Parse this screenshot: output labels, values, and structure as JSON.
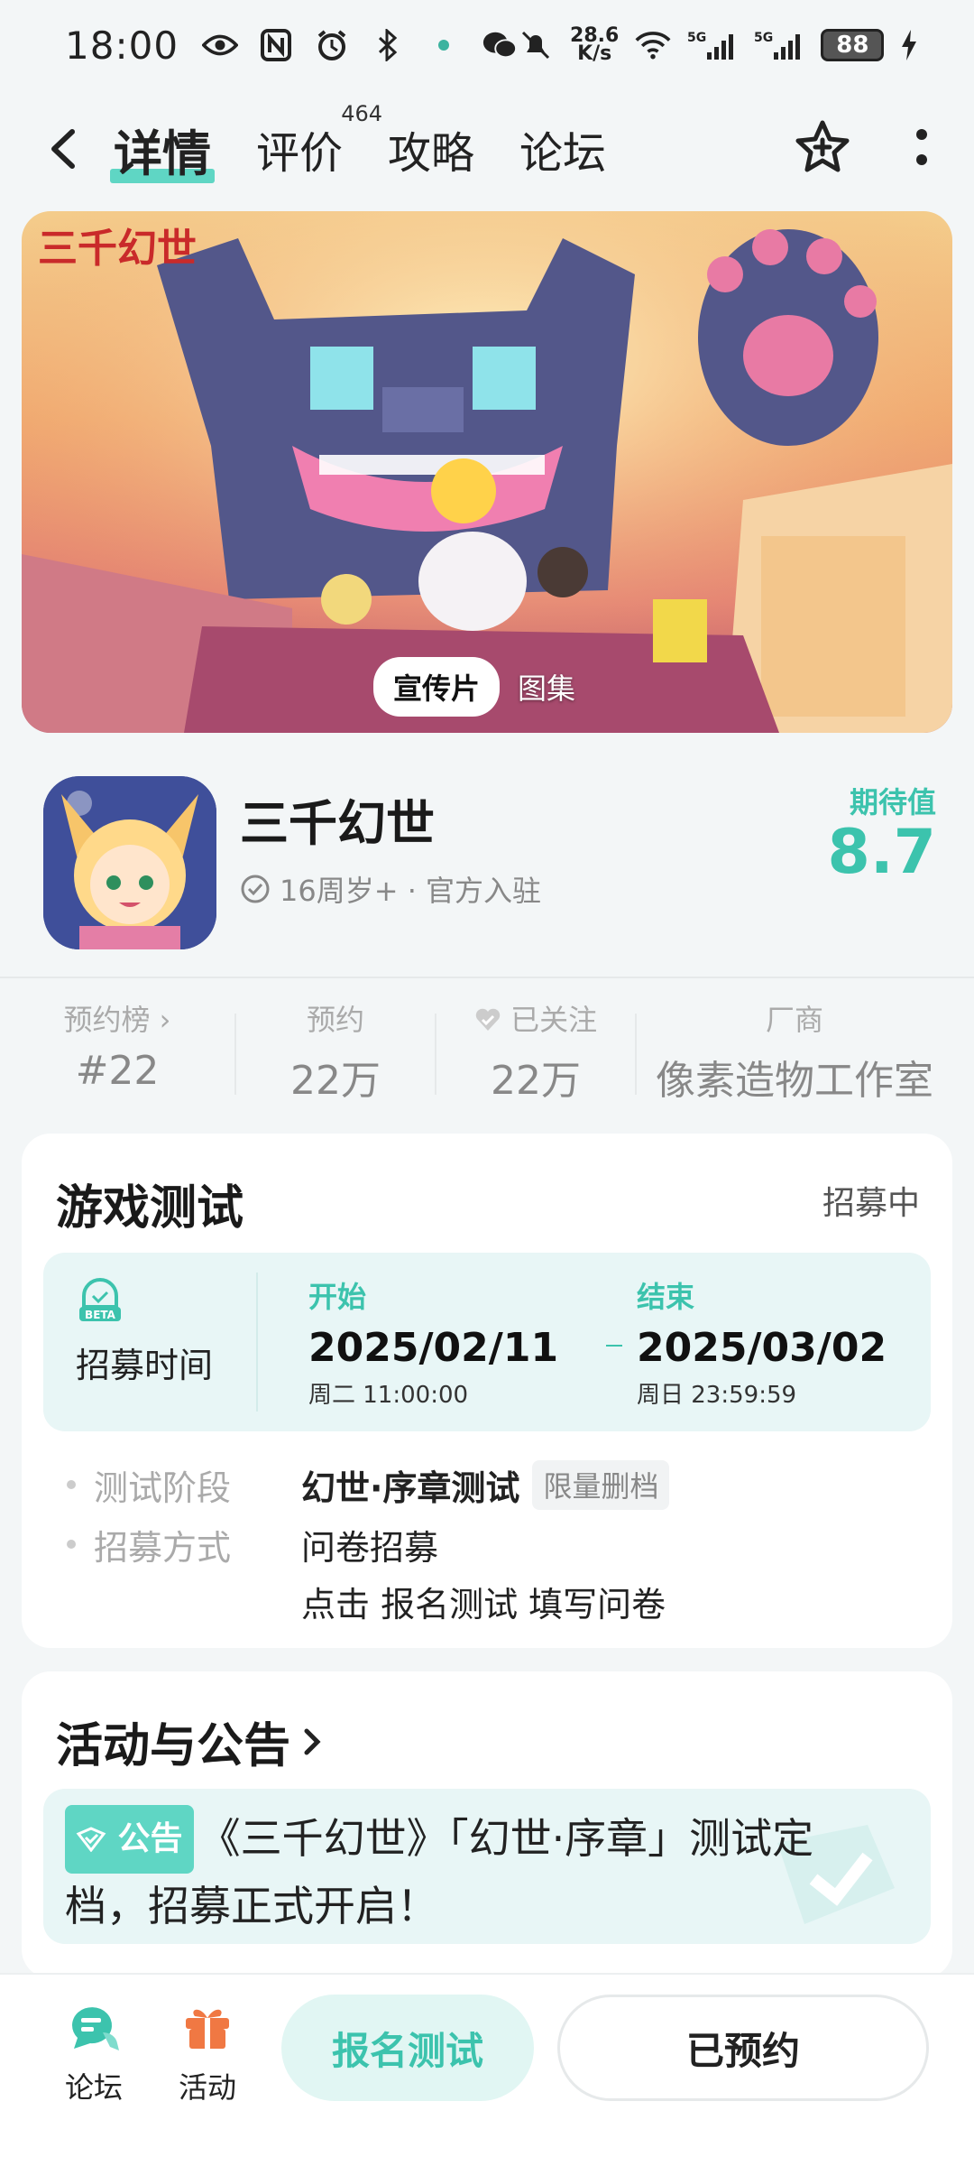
{
  "status_bar": {
    "time": "18:00",
    "net_speed_value": "28.6",
    "net_speed_unit": "K/s",
    "sig1": "5G",
    "sig2": "5G",
    "battery": "88"
  },
  "nav": {
    "tabs": [
      {
        "label": "详情",
        "active": true
      },
      {
        "label": "评价",
        "count": "464"
      },
      {
        "label": "攻略"
      },
      {
        "label": "论坛"
      }
    ]
  },
  "banner": {
    "tab_video": "宣传片",
    "tab_gallery": "图集",
    "logo_text": "三千幻世"
  },
  "game": {
    "title": "三千幻世",
    "meta": "16周岁+ · 官方入驻",
    "expect_label": "期待值",
    "expect_value": "8.7"
  },
  "stats": [
    {
      "label": "预约榜 ›",
      "value": "#22"
    },
    {
      "label": "预约",
      "value": "22万"
    },
    {
      "label": "已关注",
      "value": "22万"
    },
    {
      "label": "厂商",
      "value": "像素造物工作室"
    }
  ],
  "test_card": {
    "title": "游戏测试",
    "status": "招募中",
    "recruit_label": "招募时间",
    "beta": "BETA",
    "start_label": "开始",
    "start_date": "2025/02/11",
    "start_time": "周二  11:00:00",
    "end_label": "结束",
    "end_date": "2025/03/02",
    "end_time": "周日  23:59:59",
    "phase_label": "测试阶段",
    "phase_value": "幻世·序章测试",
    "phase_tag": "限量删档",
    "method_label": "招募方式",
    "method_value": "问卷招募",
    "method_hint": "点击 报名测试 填写问卷"
  },
  "activity_card": {
    "title": "活动与公告",
    "badge": "公告",
    "notice": "《三千幻世》「幻世·序章」测试定档，招募正式开启！"
  },
  "bottom": {
    "forum": "论坛",
    "activity": "活动",
    "signup": "报名测试",
    "reserved": "已预约"
  }
}
